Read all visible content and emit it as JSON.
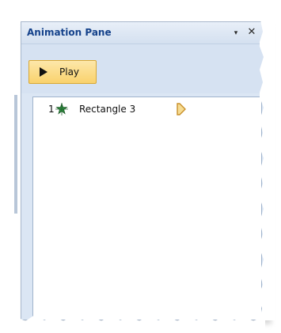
{
  "pane": {
    "title": "Animation Pane",
    "dropdown_glyph": "▾",
    "close_glyph": "✕"
  },
  "toolbar": {
    "play_label": "Play"
  },
  "animation_list": {
    "items": [
      {
        "number": "1",
        "label": "Rectangle 3",
        "effect_icon": "green-star-entrance-effect-icon",
        "trigger_icon": "timing-marker-icon"
      }
    ]
  },
  "colors": {
    "pane_background": "#dbe6f4",
    "title_text": "#15428b",
    "play_button": "#fbdc86",
    "effect_icon": "#2e8b3f",
    "trigger_marker": "#e8b84a"
  }
}
